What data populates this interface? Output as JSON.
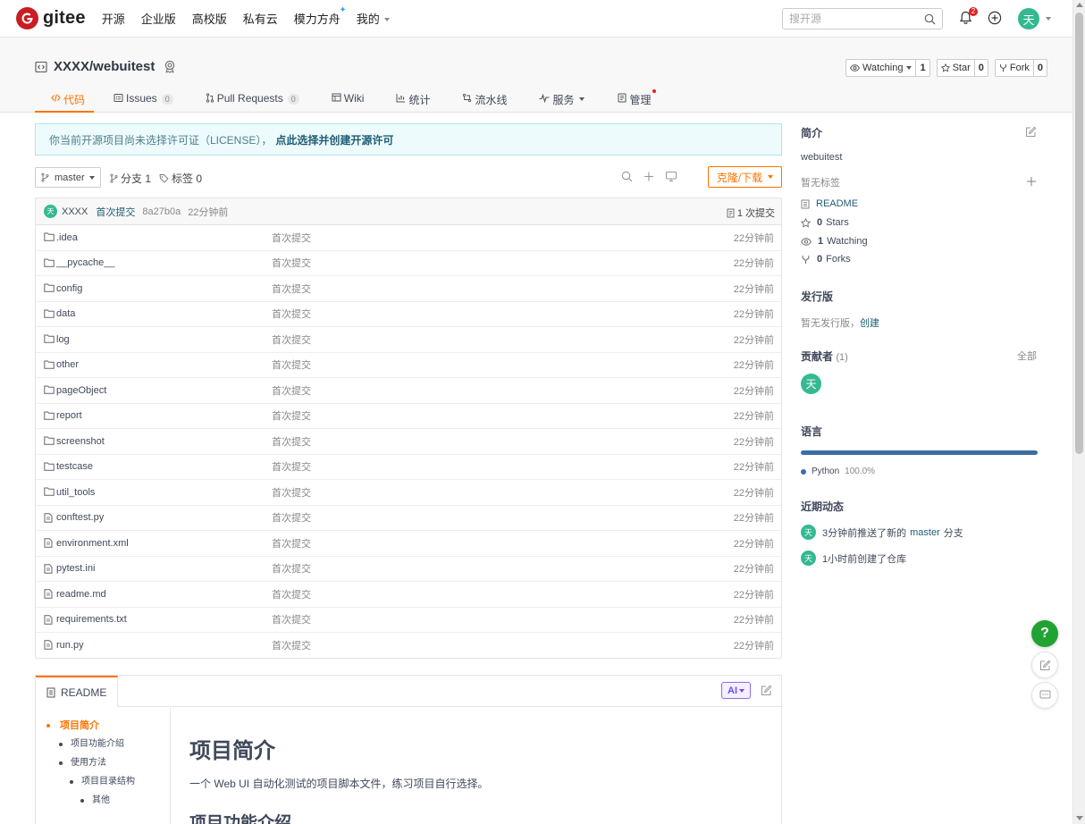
{
  "topnav": {
    "logo_text": "gitee",
    "links": [
      {
        "label": "开源"
      },
      {
        "label": "企业版"
      },
      {
        "label": "高校版"
      },
      {
        "label": "私有云"
      },
      {
        "label": "模力方舟"
      },
      {
        "label": "我的"
      }
    ],
    "search_placeholder": "搜开源",
    "notification_count": "2",
    "user_avatar_text": "天"
  },
  "repo": {
    "name": "XXXX/webuitest",
    "watching_label": "Watching",
    "watching_count": "1",
    "star_label": "Star",
    "star_count": "0",
    "fork_label": "Fork",
    "fork_count": "0",
    "tabs": [
      {
        "label": "代码"
      },
      {
        "label": "Issues",
        "count": "0"
      },
      {
        "label": "Pull Requests",
        "count": "0"
      },
      {
        "label": "Wiki"
      },
      {
        "label": "统计"
      },
      {
        "label": "流水线"
      },
      {
        "label": "服务"
      },
      {
        "label": "管理"
      }
    ]
  },
  "license": {
    "text": "你当前开源项目尚未选择许可证（LICENSE），",
    "link": "点此选择并创建开源许可"
  },
  "toolbar": {
    "branch": "master",
    "branches": "分支 1",
    "tags": "标签 0",
    "clone_label": "克隆/下载"
  },
  "commit": {
    "avatar": "天",
    "author": "XXXX",
    "message": "首次提交",
    "sha": "8a27b0a",
    "time": "22分钟前",
    "count": "1 次提交"
  },
  "files": [
    {
      "name": ".idea",
      "type": "folder",
      "msg": "首次提交",
      "time": "22分钟前"
    },
    {
      "name": "__pycache__",
      "type": "folder",
      "msg": "首次提交",
      "time": "22分钟前"
    },
    {
      "name": "config",
      "type": "folder",
      "msg": "首次提交",
      "time": "22分钟前"
    },
    {
      "name": "data",
      "type": "folder",
      "msg": "首次提交",
      "time": "22分钟前"
    },
    {
      "name": "log",
      "type": "folder",
      "msg": "首次提交",
      "time": "22分钟前"
    },
    {
      "name": "other",
      "type": "folder",
      "msg": "首次提交",
      "time": "22分钟前"
    },
    {
      "name": "pageObject",
      "type": "folder",
      "msg": "首次提交",
      "time": "22分钟前"
    },
    {
      "name": "report",
      "type": "folder",
      "msg": "首次提交",
      "time": "22分钟前"
    },
    {
      "name": "screenshot",
      "type": "folder",
      "msg": "首次提交",
      "time": "22分钟前"
    },
    {
      "name": "testcase",
      "type": "folder",
      "msg": "首次提交",
      "time": "22分钟前"
    },
    {
      "name": "util_tools",
      "type": "folder",
      "msg": "首次提交",
      "time": "22分钟前"
    },
    {
      "name": "conftest.py",
      "type": "file",
      "msg": "首次提交",
      "time": "22分钟前"
    },
    {
      "name": "environment.xml",
      "type": "file",
      "msg": "首次提交",
      "time": "22分钟前"
    },
    {
      "name": "pytest.ini",
      "type": "file",
      "msg": "首次提交",
      "time": "22分钟前"
    },
    {
      "name": "readme.md",
      "type": "file",
      "msg": "首次提交",
      "time": "22分钟前"
    },
    {
      "name": "requirements.txt",
      "type": "file",
      "msg": "首次提交",
      "time": "22分钟前"
    },
    {
      "name": "run.py",
      "type": "file",
      "msg": "首次提交",
      "time": "22分钟前"
    }
  ],
  "readme": {
    "tab_label": "README",
    "ai_label": "AI",
    "toc": [
      {
        "label": "项目简介",
        "level": 1,
        "active": true
      },
      {
        "label": "项目功能介绍",
        "level": 2
      },
      {
        "label": "使用方法",
        "level": 2
      },
      {
        "label": "项目目录结构",
        "level": 3
      },
      {
        "label": "其他",
        "level": 4
      }
    ],
    "h1": "项目简介",
    "intro": "一个 Web UI 自动化测试的项目脚本文件，练习项目自行选择。",
    "h2": "项目功能介绍"
  },
  "sidebar": {
    "about_title": "简介",
    "description": "webuitest",
    "no_tags": "暂无标签",
    "readme_link": "README",
    "stars": {
      "count": "0",
      "label": "Stars"
    },
    "watching": {
      "count": "1",
      "label": "Watching"
    },
    "forks": {
      "count": "0",
      "label": "Forks"
    },
    "release_title": "发行版",
    "release_text": "暂无发行版，",
    "release_link": "创建",
    "contrib_title": "贡献者",
    "contrib_count": "(1)",
    "contrib_all": "全部",
    "contrib_avatar": "天",
    "lang_title": "语言",
    "lang_name": "Python",
    "lang_pct": "100.0%",
    "lang_fraction": 1.0,
    "activity_title": "近期动态",
    "activity": [
      {
        "avatar": "天",
        "before": "3分钟前推送了新的",
        "branch": "master",
        "after": "分支"
      },
      {
        "avatar": "天",
        "before": "1小时前创建了仓库",
        "branch": "",
        "after": ""
      }
    ]
  },
  "floating": {
    "help": "?"
  },
  "colors": {
    "accent": "#fe7300",
    "brand": "#c71d23",
    "avatar": "#34b990",
    "python": "#3b6da4"
  }
}
